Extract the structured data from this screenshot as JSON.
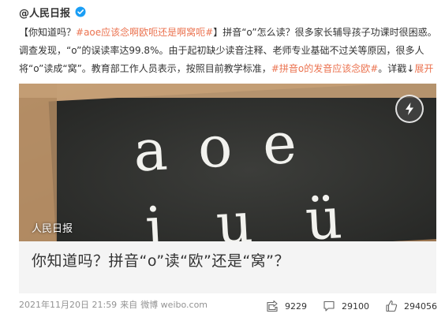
{
  "post": {
    "author": "@人民日报",
    "text_prefix": "【你知道吗？",
    "hashtag1": "#aoe应该念啊欧呃还是啊窝呃#",
    "text_body": "】拼音“o”怎么读？很多家长辅导孩子功课时很困惑。调查发现，“o”的误读率达99.8%。由于起初缺少读音注释、老师专业基础不过关等原因，很多人将“o”读成“窝”。教育部工作人员表示，按照目前教学标准，",
    "hashtag2": "#拼音o的发音应该念欧#",
    "text_suffix": "。详戳↓",
    "expand_label": "展开",
    "card": {
      "image_letters_top": "a o e",
      "image_letters_bottom": "i u ü",
      "watermark": "人民日报",
      "title": "你知道吗？拼音“o”读“欧”还是“窝”？"
    },
    "timestamp": "2021年11月20日 21:59",
    "source_prefix": "来自",
    "source": "微博 weibo.com",
    "reposts": "9229",
    "comments": "29100",
    "likes": "294056"
  },
  "colors": {
    "link": "#eb7350",
    "verified": "#1a9ef5"
  },
  "icons": [
    "verified-badge-icon",
    "lightning-icon",
    "repost-icon",
    "comment-icon",
    "like-icon",
    "chevron-down-icon"
  ]
}
